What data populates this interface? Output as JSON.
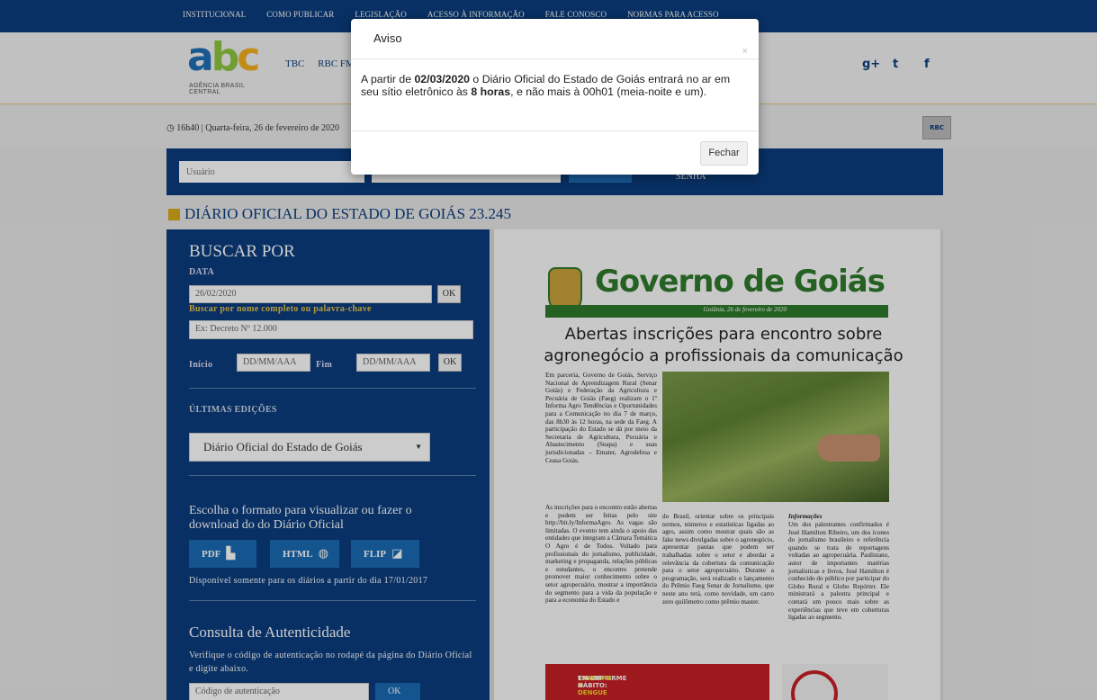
{
  "topnav": {
    "items": [
      "INSTITUCIONAL",
      "COMO PUBLICAR",
      "LEGISLAÇÃO",
      "ACESSO À INFORMAÇÃO",
      "FALE CONOSCO",
      "NORMAS PARA ACESSO"
    ]
  },
  "header": {
    "logo_text": "abc",
    "logo_sub": "AGÊNCIA BRASIL CENTRAL",
    "links": [
      "TBC",
      "RBC FM"
    ],
    "social_icons": [
      "google-plus-icon",
      "twitter-icon",
      "facebook-icon"
    ],
    "social_glyphs": [
      "g+",
      "t",
      "f"
    ]
  },
  "datebar": {
    "datetime": "16h40 | Quarta-feira, 26 de fevereiro de 2020",
    "rbc_label": "RBC"
  },
  "login": {
    "user_placeholder": "Usuário",
    "senha_label": "SENHA"
  },
  "section_title": "DIÁRIO OFICIAL DO ESTADO DE GOIÁS 23.245",
  "search": {
    "heading": "BUSCAR POR",
    "date_label": "DATA",
    "date_value": "26/02/2020",
    "ok_label": "OK",
    "keyword_label": "Buscar por nome completo ou palavra-chave",
    "keyword_placeholder": "Ex: Decreto Nº 12.000",
    "inicio_label": "Início",
    "inicio_placeholder": "DD/MM/AAA",
    "fim_label": "Fim",
    "fim_placeholder": "DD/MM/AAA"
  },
  "editions": {
    "label": "ÚLTIMAS EDIÇÕES",
    "selected": "Diário Oficial do Estado de Goiás"
  },
  "format": {
    "heading": "Escolha o formato para visualizar ou fazer o download do do Diário Oficial",
    "buttons": [
      {
        "label": "PDF",
        "icon": "pdf-file-icon",
        "glyph": "▙"
      },
      {
        "label": "HTML",
        "icon": "globe-icon",
        "glyph": "◍"
      },
      {
        "label": "FLIP",
        "icon": "page-flip-icon",
        "glyph": "◪"
      }
    ],
    "note": "Disponível somente para os diários a partir do dia 17/01/2017"
  },
  "auth": {
    "heading": "Consulta de Autenticidade",
    "desc": "Verifique o código de autenticação no rodapé da página do Diário Oficial e digite abaixo.",
    "placeholder": "Código de autenticação",
    "ok_label": "OK"
  },
  "document": {
    "masthead": "Governo de Goiás",
    "dateline": "Goiânia, 26 de fevereiro de 2020",
    "headline": "Abertas inscrições para encontro sobre agronegócio a profissionais da comunicação",
    "col1": "Em parceria, Governo de Goiás, Serviço Nacional de Aprendizagem Rural (Senar Goiás) e Federação da Agricultura e Pecuária de Goiás (Faeg) realizam o 1º Informa Agro Tendências e Oportunidades para a Comunicação no dia 7 de março, das 8h30 às 12 horas, na sede da Faeg. A participação do Estado se dá por meio da Secretaria de Agricultura, Pecuária e Abastecimento (Seapa) e suas jurisdicionadas – Emater, Agrodefesa e Ceasa Goiás.",
    "col1b": "As inscrições para o encontro estão abertas e podem ser feitas pelo site http://bit.ly/InformaAgro. As vagas são limitadas. O evento tem ainda o apoio das entidades que integram a Câmara Temática O Agro é de Todos. Voltado para profissionais do jornalismo, publicidade, marketing e propaganda, relações públicas e estudantes, o encontro pretende promover maior conhecimento sobre o setor agropecuário, mostrar a importância do segmento para a vida da população e para a economia do Estado e",
    "col2": "do Brasil, orientar sobre os principais termos, números e estatísticas ligadas ao agro, assim como mostrar quais são as fake news divulgadas sobre o agronegócio, apresentar pautas que podem ser trabalhadas sobre o setor e abordar a relevância da cobertura da comunicação para o setor agropecuário. Durante a programação, será realizado o lançamento do Prêmio Faeg Senar de Jornalismo, que neste ano terá, como novidade, um carro zero quilômetro como prêmio master.",
    "col3_title": "Informações",
    "col3": "Um dos palestrantes confirmados é José Hamilton Ribeiro, um dos ícones do jornalismo brasileiro e referência quando se trata de reportagens voltadas ao agropecuária. Paulistano, autor de importantes matérias jornalísticas e livros, José Hamilton é conhecido do público por participar do Globo Rural e Globo Repórter. Ele ministrará a palestra principal e contará um pouco mais sobre as experiências que teve em coberturas ligadas ao segmento.",
    "banner_a": "TRANSFORME O ",
    "banner_b": "COMBATE À DENGUE",
    "banner_c": " EM UM HÁBITO:"
  },
  "modal": {
    "title": "Aviso",
    "close": "×",
    "body_1": "A partir de ",
    "body_date": "02/03/2020",
    "body_2": " o Diário Oficial do Estado de Goiás entrará no ar em seu sítio eletrônico às ",
    "body_time": "8 horas",
    "body_3": ", e não mais à 00h01 (meia-noite e um).",
    "button": "Fechar"
  }
}
